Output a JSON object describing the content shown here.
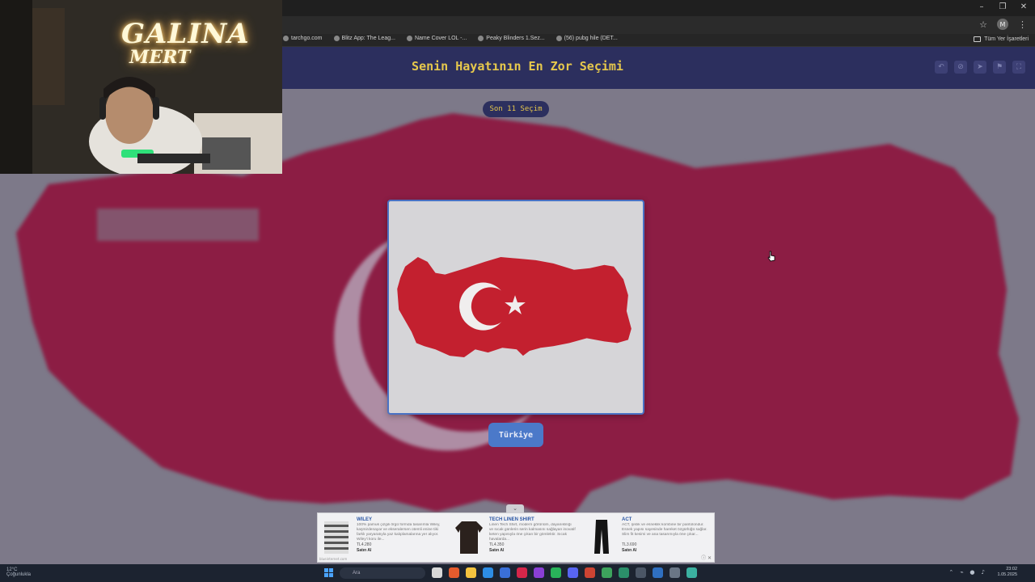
{
  "bookmarks": [
    {
      "label": "tarchgo.com"
    },
    {
      "label": "Blitz App: The Leag..."
    },
    {
      "label": "Name Cover LOL -..."
    },
    {
      "label": "Peaky Blinders 1.Sez..."
    },
    {
      "label": "(56) pubg hile (DET..."
    }
  ],
  "bookmarks_all": "Tüm Yer İşaretleri",
  "profile_initial": "M",
  "header": {
    "title": "Senin Hayatının En Zor Seçimi"
  },
  "progress_pill": "Son 11 Seçim",
  "choice": {
    "button_label": "Türkiye",
    "image": "turkey-flag-map"
  },
  "ad": {
    "items": [
      {
        "name": "WILEY",
        "desc": "100% pamuk çizgili örgü formda tasarımla Wiley, kaşmirdenayar ve ekseralersen otemli enine tiki farklı yaryaratıyla yaz kalıplamalarına yer alıyor. Wiley'i koru ile...",
        "price": "TL4.280",
        "buy": "Satın Al"
      },
      {
        "name": "TECH LINEN SHIRT",
        "desc": "Linen Tech Shirt, modern görünüm, dayanıklılığı ve sıcak günlerin serin kalmasını sağlayan inovatif keten yapısıyla öne çıkan bir gömlektir. Sıcak havalarda...",
        "price": "TL4.350",
        "buy": "Satın Al"
      },
      {
        "name": "ACT",
        "desc": "ACT, şıklık ve esneklik kombine bir pantolondur. Esnek yapısı sayesinde hareket özgürlüğü sağlar. Slim fit kesimi ve ana tasarımıyla öne çıkar...",
        "price": "TL3.690",
        "buy": "Satın Al"
      }
    ],
    "footer": "blueinternet.com"
  },
  "taskbar": {
    "weather_temp": "12°C",
    "weather_desc": "Çoğunlukla",
    "search_placeholder": "Ara",
    "time": "23:02",
    "date": "1.05.2025"
  },
  "webcam": {
    "neon_top": "GALINA",
    "neon_bottom": "MERT"
  },
  "colors": {
    "header_bg": "#2c2f5e",
    "title_gold": "#e6c84c",
    "button_blue": "#4b79c9",
    "flag_red": "#c3202f",
    "bg_map_red": "#8c1d44"
  }
}
